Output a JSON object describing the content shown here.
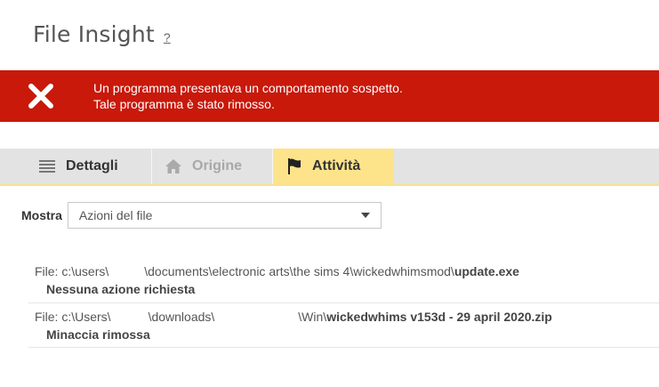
{
  "header": {
    "title": "File Insight",
    "help_label": "?"
  },
  "alert": {
    "icon": "close-x-icon",
    "line1": "Un programma presentava un comportamento sospetto.",
    "line2": "Tale programma è stato rimosso.",
    "color": "#c8190b"
  },
  "tabs": [
    {
      "label": "Dettagli",
      "icon": "list-icon",
      "active": false,
      "enabled": true
    },
    {
      "label": "Origine",
      "icon": "home-icon",
      "active": false,
      "enabled": false
    },
    {
      "label": "Attività",
      "icon": "flag-icon",
      "active": true,
      "enabled": true
    }
  ],
  "filter": {
    "label": "Mostra",
    "selected": "Azioni del file"
  },
  "entries": [
    {
      "path_prefix": "File: c:\\users\\",
      "path_middle": "\\documents\\electronic arts\\the sims 4\\wickedwhimsmod\\",
      "file_name": "update.exe",
      "status": "Nessuna azione richiesta"
    },
    {
      "path_prefix": "File: c:\\Users\\",
      "path_middle": "\\downloads\\",
      "path_middle2": "\\Win\\",
      "file_name": "wickedwhims v153d - 29 april 2020.zip",
      "status": "Minaccia rimossa"
    }
  ]
}
